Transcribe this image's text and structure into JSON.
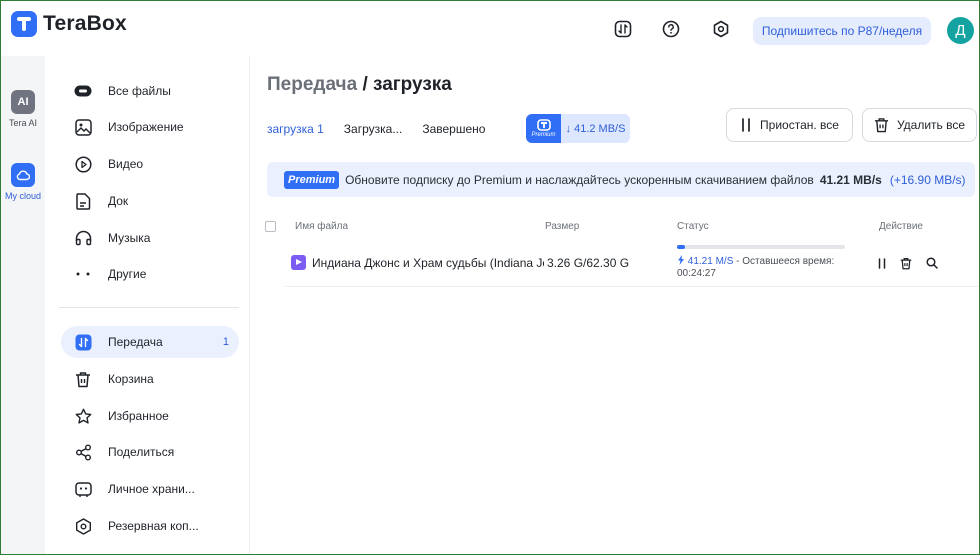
{
  "app": {
    "name": "TeraBox"
  },
  "header": {
    "subscribe_label": "Подпишитесь по Р87/неделя",
    "avatar_letter": "Д"
  },
  "rail": {
    "items": [
      {
        "badge": "AI",
        "label": "Tera AI"
      },
      {
        "label": "My cloud"
      }
    ]
  },
  "sidebar": {
    "items": [
      {
        "label": "Все файлы"
      },
      {
        "label": "Изображение"
      },
      {
        "label": "Видео"
      },
      {
        "label": "Док"
      },
      {
        "label": "Музыка"
      },
      {
        "label": "Другие"
      },
      {
        "label": "Передача",
        "count": "1"
      },
      {
        "label": "Корзина"
      },
      {
        "label": "Избранное"
      },
      {
        "label": "Поделиться"
      },
      {
        "label": "Личное храни..."
      },
      {
        "label": "Резервная коп..."
      }
    ]
  },
  "main": {
    "title_crumb": "Передача",
    "title_sep": "/",
    "title_current": "загрузка",
    "tabs": [
      {
        "label": "загрузка 1"
      },
      {
        "label": "Загрузка..."
      },
      {
        "label": "Завершено"
      }
    ],
    "speed_pill": {
      "tag": "Premium",
      "value": "↓ 41.2 MB/S"
    },
    "pause_all_label": "Приостан. все",
    "delete_all_label": "Удалить все",
    "banner": {
      "tag": "Premium",
      "text": "Обновите подписку до Premium и наслаждайтесь ускоренным скачиванием файлов",
      "speed": "41.21 MB/s",
      "bonus": "(+16.90 MB/s)"
    },
    "table": {
      "headers": {
        "name": "Имя файла",
        "size": "Размер",
        "status": "Статус",
        "action": "Действие"
      },
      "rows": [
        {
          "name": "Индиана Джонс и Храм судьбы (Indiana Jones and the Temple of Doom)",
          "size": "3.26 G/62.30 G",
          "progress": 0.05,
          "speed": "41.21 M/S",
          "remaining_label": "- Оставшееся время:",
          "remaining": "00:24:27"
        }
      ]
    }
  },
  "colors": {
    "accent": "#2f6ef5",
    "avatar": "#15a3a1",
    "video": "#7c5cf2"
  }
}
